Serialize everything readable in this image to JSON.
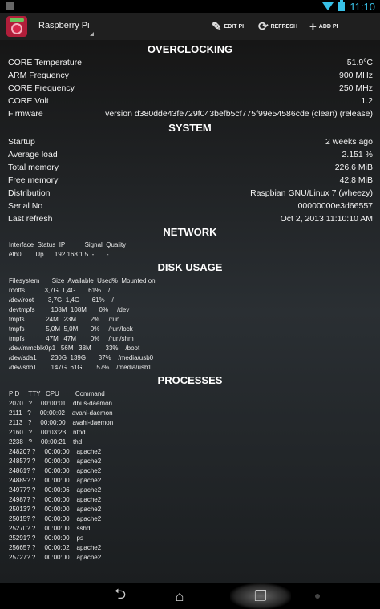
{
  "status_bar": {
    "time": "11:10",
    "icons": [
      "notification-icon",
      "wifi-icon",
      "battery-icon"
    ]
  },
  "action_bar": {
    "title": "Raspberry Pi",
    "edit_label": "EDIT PI",
    "refresh_label": "REFRESH",
    "add_label": "ADD PI"
  },
  "overclocking": {
    "title": "OVERCLOCKING",
    "rows": [
      {
        "key": "CORE Temperature",
        "value": "51.9°C"
      },
      {
        "key": "ARM Frequency",
        "value": "900 MHz"
      },
      {
        "key": "CORE Frequency",
        "value": "250 MHz"
      },
      {
        "key": "CORE Volt",
        "value": "1.2"
      },
      {
        "key": "Firmware",
        "value": "version d380dde43fe729f043befb5cf775f99e54586cde (clean) (release)"
      }
    ]
  },
  "system": {
    "title": "SYSTEM",
    "rows": [
      {
        "key": "Startup",
        "value": "2 weeks ago"
      },
      {
        "key": "Average load",
        "value": "2.151 %"
      },
      {
        "key": "Total memory",
        "value": "226.6 MiB"
      },
      {
        "key": "Free memory",
        "value": "42.8 MiB"
      },
      {
        "key": "Distribution",
        "value": "Raspbian GNU/Linux 7 (wheezy)"
      },
      {
        "key": "Serial No",
        "value": "00000000e3d66557"
      },
      {
        "key": "Last refresh",
        "value": "Oct 2, 2013 11:10:10 AM"
      }
    ]
  },
  "network": {
    "title": "NETWORK",
    "header": "Interface  Status  IP           Signal  Quality",
    "row": "eth0        Up      192.168.1.5  -       -"
  },
  "disk_usage": {
    "title": "DISK USAGE",
    "header": "Filesystem       Size  Available  Used%  Mounted on",
    "rows": [
      "rootfs           3,7G  1,4G       61%    /",
      "/dev/root        3,7G  1,4G       61%    /",
      "devtmpfs         108M  108M       0%     /dev",
      "tmpfs            24M   23M        2%     /run",
      "tmpfs            5,0M  5,0M       0%     /run/lock",
      "tmpfs            47M   47M        0%     /run/shm",
      "/dev/mmcblk0p1   56M   38M        33%    /boot",
      "/dev/sda1        230G  139G       37%    /media/usb0",
      "/dev/sdb1        147G  61G        57%    /media/usb1"
    ]
  },
  "processes": {
    "title": "PROCESSES",
    "header": "PID     TTY   CPU         Command",
    "rows": [
      "2070   ?     00:00:01    dbus-daemon",
      "2111   ?     00:00:02    avahi-daemon",
      "2113   ?     00:00:00    avahi-daemon",
      "2160   ?     00:03:23    ntpd",
      "2238   ?     00:00:21    thd",
      "24820? ?     00:00:00    apache2",
      "24857? ?     00:00:00    apache2",
      "24861? ?     00:00:00    apache2",
      "24889? ?     00:00:00    apache2",
      "24977? ?     00:00:06    apache2",
      "24987? ?     00:00:00    apache2",
      "25013? ?     00:00:00    apache2",
      "25015? ?     00:00:00    apache2",
      "25270? ?     00:00:00    sshd",
      "25291? ?     00:00:00    ps",
      "25665? ?     00:00:02    apache2",
      "25727? ?     00:00:00    apache2"
    ]
  },
  "nav_bar": {
    "icons": [
      "back-icon",
      "home-icon",
      "recent-apps-icon",
      "menu-dot-icon"
    ]
  },
  "colors": {
    "accent": "#38c0e6",
    "action_bar_bg": "#1f1f1f",
    "content_bg": "#22272a"
  }
}
